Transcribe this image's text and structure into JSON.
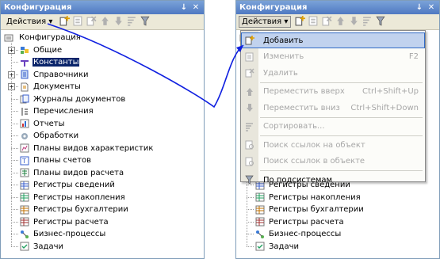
{
  "panel_title": "Конфигурация",
  "title_buttons": {
    "pin": "↓",
    "close": "✕"
  },
  "actions_label": "Действия ▾",
  "toolbar_icons": [
    "add-icon",
    "edit-icon",
    "delete-icon",
    "move-up-icon",
    "move-down-icon",
    "sort-icon",
    "filter-icon"
  ],
  "tree": {
    "root": "Конфигурация",
    "items": [
      {
        "label": "Общие",
        "expander": "+",
        "icon": "general-icon"
      },
      {
        "label": "Константы",
        "expander": "",
        "icon": "constants-icon",
        "selected": true
      },
      {
        "label": "Справочники",
        "expander": "+",
        "icon": "catalogs-icon"
      },
      {
        "label": "Документы",
        "expander": "+",
        "icon": "documents-icon"
      },
      {
        "label": "Журналы документов",
        "expander": "",
        "icon": "journals-icon"
      },
      {
        "label": "Перечисления",
        "expander": "",
        "icon": "enums-icon"
      },
      {
        "label": "Отчеты",
        "expander": "",
        "icon": "reports-icon"
      },
      {
        "label": "Обработки",
        "expander": "",
        "icon": "dataprocessors-icon"
      },
      {
        "label": "Планы видов характеристик",
        "expander": "",
        "icon": "charts-of-characteristics-icon"
      },
      {
        "label": "Планы счетов",
        "expander": "",
        "icon": "charts-of-accounts-icon"
      },
      {
        "label": "Планы видов расчета",
        "expander": "",
        "icon": "charts-of-calculation-icon"
      },
      {
        "label": "Регистры сведений",
        "expander": "",
        "icon": "info-registers-icon"
      },
      {
        "label": "Регистры накопления",
        "expander": "",
        "icon": "accumulation-registers-icon"
      },
      {
        "label": "Регистры бухгалтерии",
        "expander": "",
        "icon": "accounting-registers-icon"
      },
      {
        "label": "Регистры расчета",
        "expander": "",
        "icon": "calculation-registers-icon"
      },
      {
        "label": "Бизнес-процессы",
        "expander": "",
        "icon": "business-processes-icon"
      },
      {
        "label": "Задачи",
        "expander": "",
        "icon": "tasks-icon"
      }
    ]
  },
  "menu": {
    "items": [
      {
        "label": "Добавить",
        "shortcut": "",
        "enabled": true,
        "hot": true,
        "icon": "add-icon"
      },
      {
        "label": "Изменить",
        "shortcut": "F2",
        "enabled": false,
        "icon": "edit-icon"
      },
      {
        "label": "Удалить",
        "shortcut": "",
        "enabled": false,
        "icon": "delete-icon"
      },
      {
        "label": "Переместить вверх",
        "shortcut": "Ctrl+Shift+Up",
        "enabled": false,
        "icon": "move-up-icon"
      },
      {
        "label": "Переместить вниз",
        "shortcut": "Ctrl+Shift+Down",
        "enabled": false,
        "icon": "move-down-icon"
      },
      {
        "label": "Сортировать...",
        "shortcut": "",
        "enabled": false,
        "icon": "sort-icon"
      },
      {
        "label": "Поиск ссылок на объект",
        "shortcut": "",
        "enabled": false,
        "icon": "find-refs-icon"
      },
      {
        "label": "Поиск ссылок в объекте",
        "shortcut": "",
        "enabled": false,
        "icon": "find-refs-in-icon"
      },
      {
        "label": "По подсистемам",
        "shortcut": "",
        "enabled": true,
        "icon": "subsystem-filter-icon"
      }
    ]
  },
  "colors": {
    "title_bar": "#4f79c2",
    "selection": "#0a246a",
    "menu_highlight": "#c1d2ee",
    "arrow": "#1020e0"
  }
}
